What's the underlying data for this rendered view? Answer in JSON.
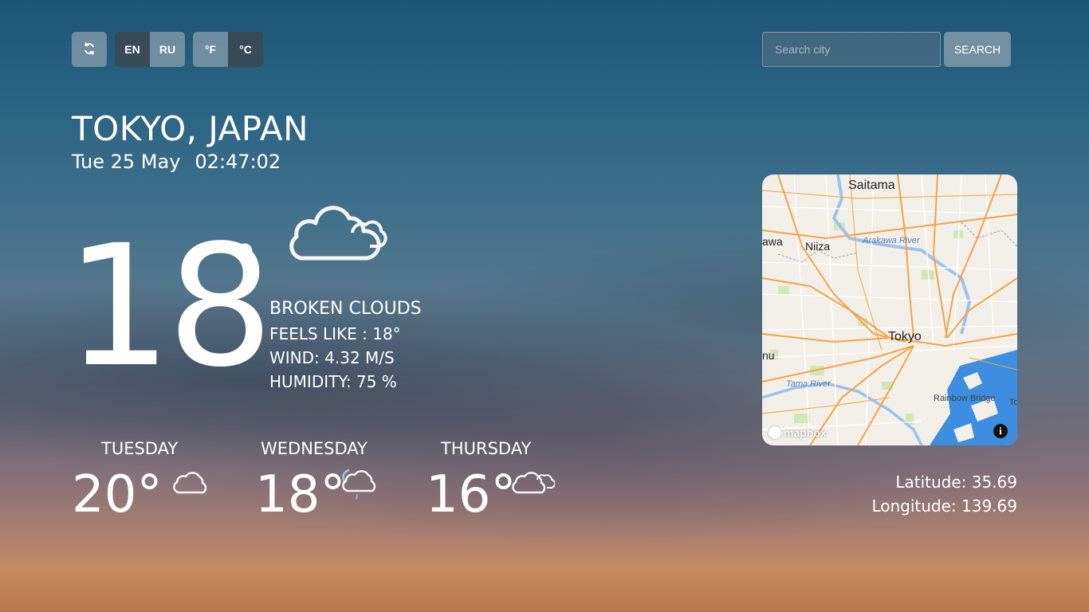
{
  "toolbar": {
    "refresh_icon": "refresh-icon",
    "lang_en": "EN",
    "lang_ru": "RU",
    "unit_f": "°F",
    "unit_c": "°C"
  },
  "search": {
    "placeholder": "Search city",
    "value": "",
    "button_label": "SEARCH"
  },
  "location": {
    "name": "TOKYO, JAPAN",
    "date": "Tue 25 May",
    "time": "02:47:02"
  },
  "current": {
    "temperature": "18",
    "degree": "°",
    "icon": "broken-clouds-icon",
    "condition": "BROKEN CLOUDS",
    "feels_like": "FEELS LIKE : 18°",
    "wind": "WIND: 4.32 M/S",
    "humidity": "HUMIDITY: 75 %"
  },
  "forecast": [
    {
      "day": "TUESDAY",
      "temp": "20°",
      "icon": "cloud-icon"
    },
    {
      "day": "WEDNESDAY",
      "temp": "18°",
      "icon": "cloud-rain-icon"
    },
    {
      "day": "THURSDAY",
      "temp": "16°",
      "icon": "broken-clouds-icon"
    }
  ],
  "map": {
    "labels": {
      "saitama": "Saitama",
      "niiza": "Niiza",
      "tokyo": "Tokyo",
      "arakawa": "Arakawa River",
      "tama": "Tama River",
      "rainbow": "Rainbow Bridge",
      "awa": "awa",
      "nu": "nu",
      "to": "To"
    },
    "logo": "mapbox",
    "info": "i"
  },
  "coordinates": {
    "latitude": "Latitude: 35.69",
    "longitude": "Longitude: 139.69"
  },
  "colors": {
    "button_light": "#7d96a5",
    "button_dark": "#3c4850",
    "text": "#ffffff",
    "map_water": "#2f86d6",
    "map_road": "#f2a44a"
  }
}
